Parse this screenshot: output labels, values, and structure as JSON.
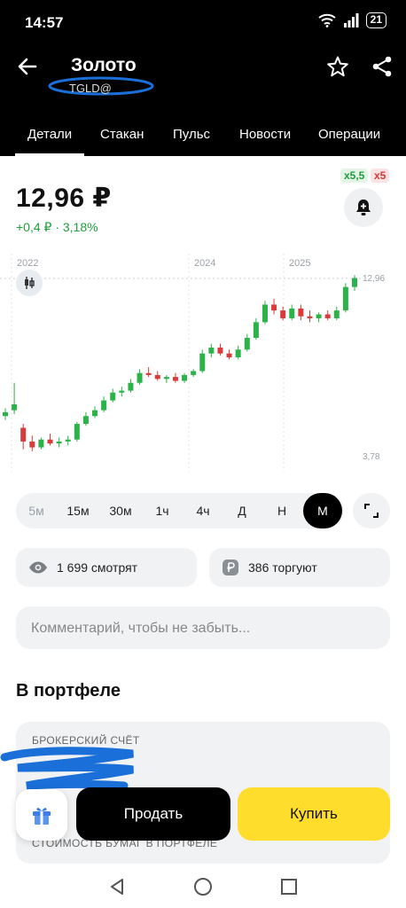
{
  "status": {
    "time": "14:57",
    "battery": "21"
  },
  "header": {
    "title": "Золото",
    "ticker": "TGLD@"
  },
  "tabs": [
    {
      "label": "Детали",
      "active": true
    },
    {
      "label": "Стакан"
    },
    {
      "label": "Пульс"
    },
    {
      "label": "Новости"
    },
    {
      "label": "Операции"
    }
  ],
  "quote": {
    "price": "12,96 ₽",
    "change": "+0,4 ₽ · 3,18%",
    "leverage_long": "x5,5",
    "leverage_short": "x5"
  },
  "chart_data": {
    "type": "candlestick",
    "year_labels": [
      "2022",
      "2024",
      "2025"
    ],
    "price_labels": [
      "12,96",
      "3,78"
    ],
    "ylim": [
      3.78,
      13.3
    ],
    "candles": [
      {
        "o": 5.9,
        "h": 6.3,
        "l": 5.7,
        "c": 6.1
      },
      {
        "o": 6.2,
        "h": 7.6,
        "l": 6.0,
        "c": 6.5
      },
      {
        "o": 5.3,
        "h": 5.5,
        "l": 4.2,
        "c": 4.6
      },
      {
        "o": 4.6,
        "h": 4.9,
        "l": 4.1,
        "c": 4.3
      },
      {
        "o": 4.3,
        "h": 4.8,
        "l": 4.2,
        "c": 4.7
      },
      {
        "o": 4.7,
        "h": 5.0,
        "l": 4.4,
        "c": 4.5
      },
      {
        "o": 4.5,
        "h": 4.8,
        "l": 4.3,
        "c": 4.6
      },
      {
        "o": 4.6,
        "h": 4.9,
        "l": 4.4,
        "c": 4.7
      },
      {
        "o": 4.7,
        "h": 5.6,
        "l": 4.6,
        "c": 5.5
      },
      {
        "o": 5.5,
        "h": 6.1,
        "l": 5.4,
        "c": 5.9
      },
      {
        "o": 5.9,
        "h": 6.4,
        "l": 5.8,
        "c": 6.2
      },
      {
        "o": 6.2,
        "h": 6.9,
        "l": 6.1,
        "c": 6.7
      },
      {
        "o": 6.7,
        "h": 7.3,
        "l": 6.6,
        "c": 7.1
      },
      {
        "o": 7.1,
        "h": 7.4,
        "l": 6.9,
        "c": 7.2
      },
      {
        "o": 7.2,
        "h": 7.8,
        "l": 7.1,
        "c": 7.6
      },
      {
        "o": 7.6,
        "h": 8.3,
        "l": 7.5,
        "c": 8.1
      },
      {
        "o": 8.1,
        "h": 8.4,
        "l": 7.9,
        "c": 8.0
      },
      {
        "o": 8.0,
        "h": 8.2,
        "l": 7.7,
        "c": 7.8
      },
      {
        "o": 7.8,
        "h": 8.0,
        "l": 7.6,
        "c": 7.9
      },
      {
        "o": 7.9,
        "h": 8.1,
        "l": 7.6,
        "c": 7.7
      },
      {
        "o": 7.7,
        "h": 8.1,
        "l": 7.6,
        "c": 8.0
      },
      {
        "o": 8.0,
        "h": 8.3,
        "l": 7.9,
        "c": 8.2
      },
      {
        "o": 8.2,
        "h": 9.3,
        "l": 8.1,
        "c": 9.1
      },
      {
        "o": 9.1,
        "h": 9.6,
        "l": 8.9,
        "c": 9.4
      },
      {
        "o": 9.4,
        "h": 9.6,
        "l": 9.0,
        "c": 9.1
      },
      {
        "o": 9.1,
        "h": 9.3,
        "l": 8.8,
        "c": 8.9
      },
      {
        "o": 8.9,
        "h": 9.5,
        "l": 8.8,
        "c": 9.3
      },
      {
        "o": 9.3,
        "h": 10.1,
        "l": 9.2,
        "c": 9.9
      },
      {
        "o": 9.9,
        "h": 10.9,
        "l": 9.8,
        "c": 10.7
      },
      {
        "o": 10.7,
        "h": 11.8,
        "l": 10.6,
        "c": 11.6
      },
      {
        "o": 11.6,
        "h": 11.9,
        "l": 11.1,
        "c": 11.3
      },
      {
        "o": 11.3,
        "h": 11.5,
        "l": 10.8,
        "c": 10.9
      },
      {
        "o": 10.9,
        "h": 11.6,
        "l": 10.8,
        "c": 11.4
      },
      {
        "o": 11.4,
        "h": 11.6,
        "l": 10.8,
        "c": 11.0
      },
      {
        "o": 11.0,
        "h": 11.3,
        "l": 10.7,
        "c": 10.9
      },
      {
        "o": 10.9,
        "h": 11.2,
        "l": 10.7,
        "c": 11.1
      },
      {
        "o": 11.1,
        "h": 11.3,
        "l": 10.8,
        "c": 10.9
      },
      {
        "o": 10.9,
        "h": 11.5,
        "l": 10.8,
        "c": 11.3
      },
      {
        "o": 11.3,
        "h": 12.7,
        "l": 11.2,
        "c": 12.5
      },
      {
        "o": 12.5,
        "h": 13.1,
        "l": 12.3,
        "c": 12.96
      }
    ]
  },
  "timeframes": [
    "5м",
    "15м",
    "30м",
    "1ч",
    "4ч",
    "Д",
    "Н",
    "М"
  ],
  "active_timeframe": "М",
  "stats": {
    "watching": "1 699 смотрят",
    "trading": "386 торгуют"
  },
  "comment": {
    "placeholder": "Комментарий, чтобы не забыть..."
  },
  "portfolio": {
    "title": "В портфеле",
    "account_label": "БРОКЕРСКИЙ СЧЁТ",
    "value_label": "СТОИМОСТЬ БУМАГ В ПОРТФЕЛЕ"
  },
  "actions": {
    "sell": "Продать",
    "buy": "Купить"
  },
  "colors": {
    "up": "#2bb34a",
    "down": "#d93a3a",
    "buy": "#ffdd2d",
    "accent_dark": "#000000"
  }
}
